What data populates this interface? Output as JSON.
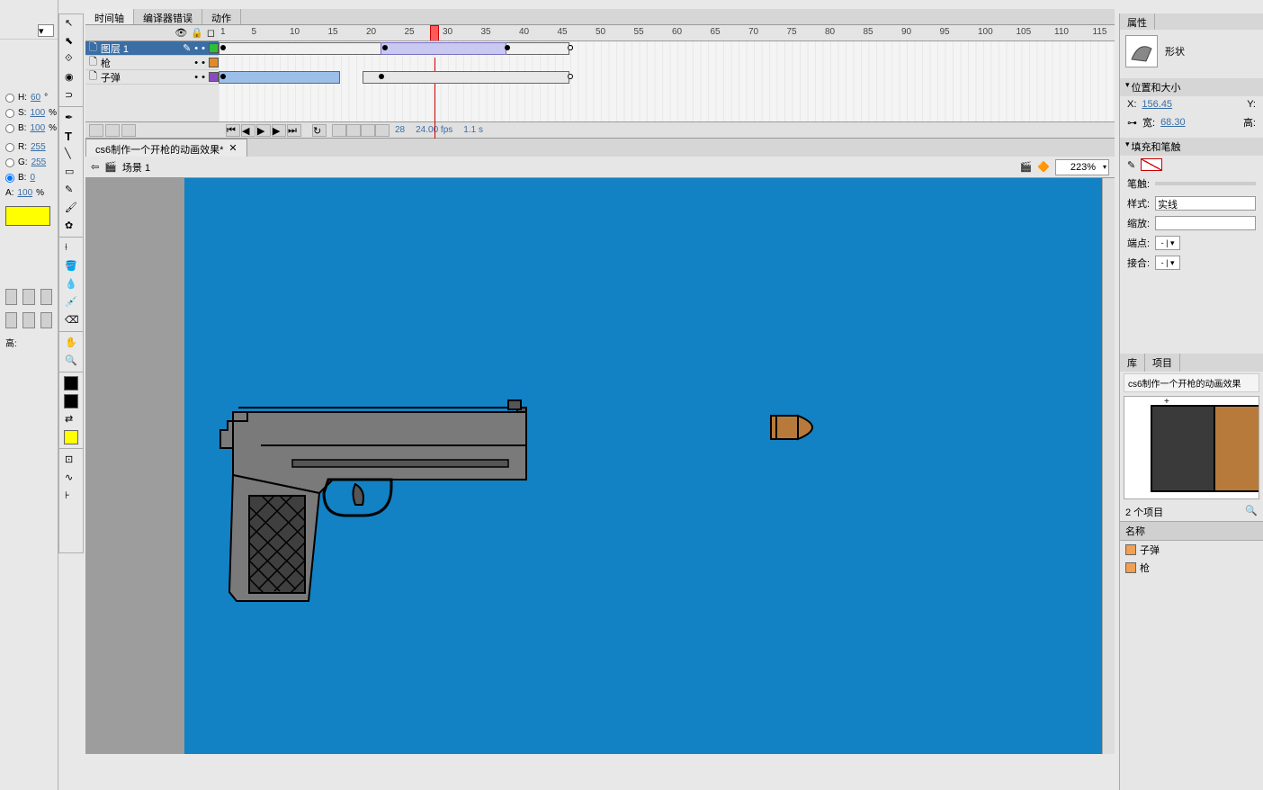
{
  "left": {
    "H": {
      "label": "H:",
      "value": "60",
      "unit": "°"
    },
    "S": {
      "label": "S:",
      "value": "100",
      "unit": "%"
    },
    "Br": {
      "label": "B:",
      "value": "100",
      "unit": "%"
    },
    "R": {
      "label": "R:",
      "value": "255"
    },
    "G": {
      "label": "G:",
      "value": "255"
    },
    "B": {
      "label": "B:",
      "value": "0"
    },
    "A": {
      "label": "A:",
      "value": "100",
      "unit": "%"
    }
  },
  "tabs": {
    "timeline": "时间轴",
    "compilerErrors": "编译器错误",
    "actions": "动作"
  },
  "ruler": {
    "start": 1,
    "step": 5,
    "count": 28
  },
  "playhead": {
    "frame": 28
  },
  "layers": [
    {
      "name": "图层 1",
      "color": "#2bbf3a",
      "selected": true
    },
    {
      "name": "枪",
      "color": "#e08a2a",
      "selected": false
    },
    {
      "name": "子弹",
      "color": "#8a4bbf",
      "selected": false
    }
  ],
  "tlinfo": {
    "frame": "28",
    "fps": "24.00 fps",
    "time": "1.1 s"
  },
  "doc": {
    "title": "cs6制作一个开枪的动画效果*",
    "scene": "场景 1",
    "zoom": "223%"
  },
  "properties": {
    "tab": "属性",
    "type": "形状",
    "groups": {
      "posSize": "位置和大小",
      "fillStroke": "填充和笔触"
    },
    "pos": {
      "xLabel": "X:",
      "x": "156.45",
      "yLabel": "Y:"
    },
    "size": {
      "wLabel": "宽:",
      "w": "68.30",
      "hLabel": "高:"
    },
    "stroke": {
      "strokeLabel": "笔触:",
      "styleLabel": "样式:",
      "style": "实线",
      "scaleLabel": "缩放:",
      "capLabel": "端点:",
      "joinLabel": "接合:",
      "comboVal": "- | ▾"
    }
  },
  "library": {
    "tabs": {
      "lib": "库",
      "proj": "项目"
    },
    "file": "cs6制作一个开枪的动画效果",
    "count": "2 个项目",
    "nameHdr": "名称",
    "items": [
      {
        "name": "子弹"
      },
      {
        "name": "枪"
      }
    ]
  },
  "icons": {
    "arrow": "↖",
    "subselect": "⬉",
    "freetransform": "⟐",
    "lasso": "⊃",
    "pen": "✒",
    "text": "T",
    "line": "╲",
    "rect": "▭",
    "pencil": "✎",
    "brush": "🖌",
    "deco": "✿",
    "bone": "⟊",
    "paint": "🪣",
    "ink": "💧",
    "eraser": "⌫",
    "hand": "✋",
    "zoom": "🔍"
  }
}
